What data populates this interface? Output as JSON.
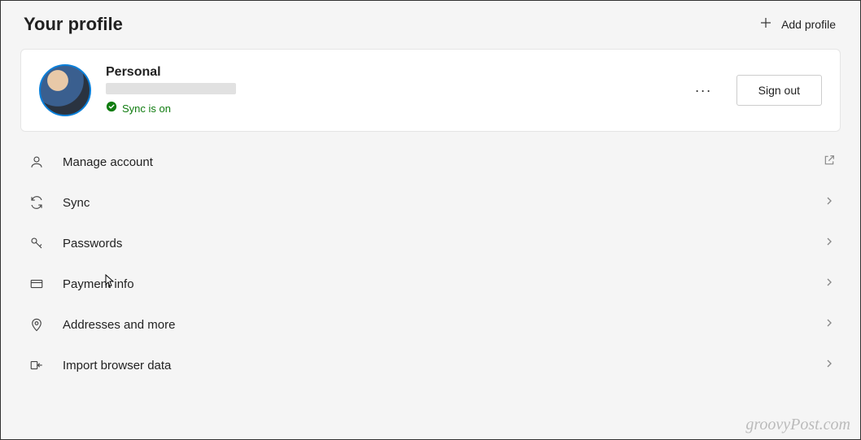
{
  "header": {
    "title": "Your profile",
    "add_profile_label": "Add profile"
  },
  "profile": {
    "name": "Personal",
    "email_redacted": true,
    "sync_status": "Sync is on",
    "sync_status_color": "#107c10",
    "more_label": "···",
    "signout_label": "Sign out"
  },
  "menu": [
    {
      "id": "manage-account",
      "icon": "person",
      "label": "Manage account",
      "trailing": "external"
    },
    {
      "id": "sync",
      "icon": "sync",
      "label": "Sync",
      "trailing": "chevron"
    },
    {
      "id": "passwords",
      "icon": "key",
      "label": "Passwords",
      "trailing": "chevron"
    },
    {
      "id": "payment-info",
      "icon": "card",
      "label": "Payment info",
      "trailing": "chevron"
    },
    {
      "id": "addresses",
      "icon": "location",
      "label": "Addresses and more",
      "trailing": "chevron"
    },
    {
      "id": "import-data",
      "icon": "import",
      "label": "Import browser data",
      "trailing": "chevron"
    }
  ],
  "watermark": "groovyPost.com"
}
